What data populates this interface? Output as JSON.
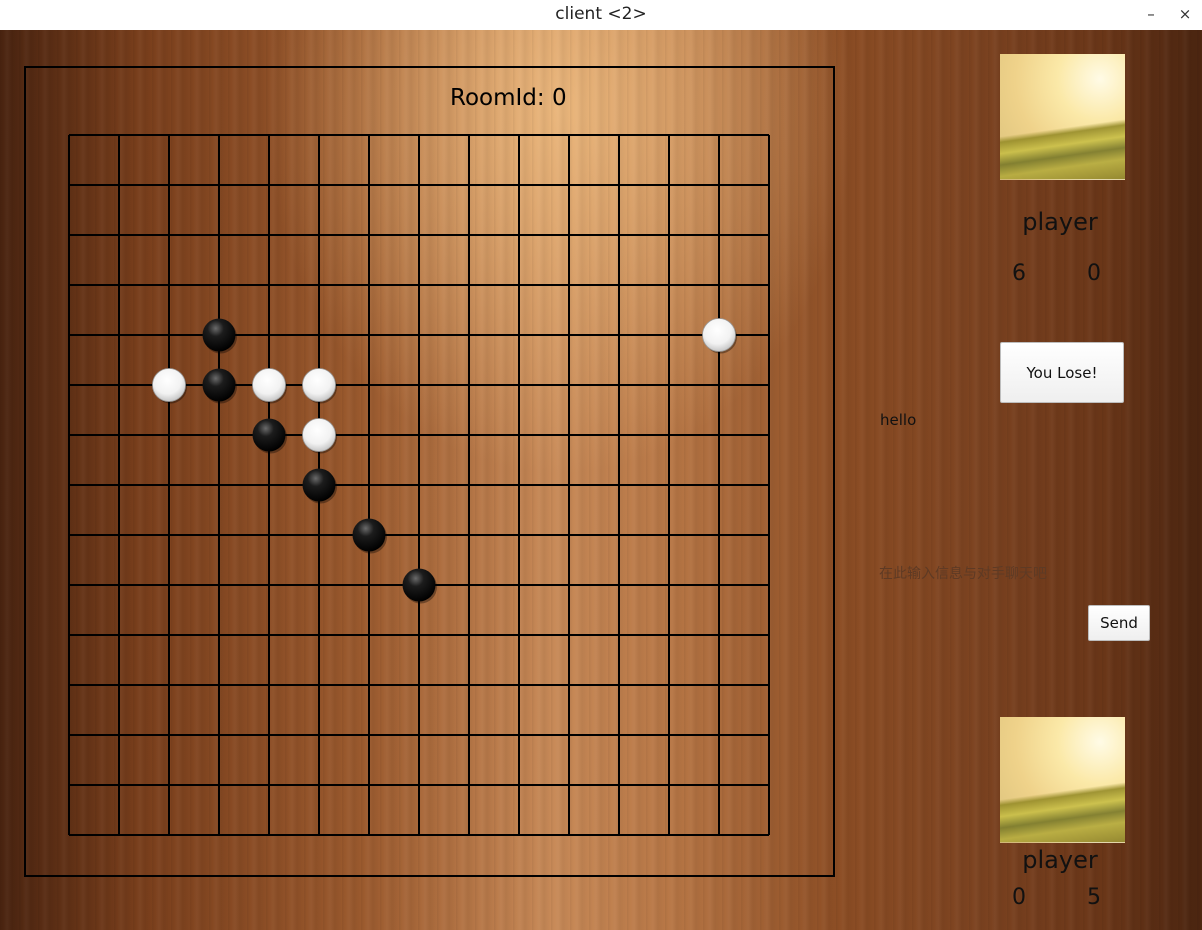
{
  "window": {
    "title": "client <2>",
    "minimize_glyph": "–",
    "close_glyph": "×"
  },
  "room": {
    "label": "RoomId: 0"
  },
  "board": {
    "size": 15,
    "black_stones": [
      [
        3,
        4
      ],
      [
        3,
        5
      ],
      [
        4,
        6
      ],
      [
        5,
        7
      ],
      [
        6,
        8
      ],
      [
        7,
        9
      ]
    ],
    "white_stones": [
      [
        2,
        5
      ],
      [
        4,
        5
      ],
      [
        5,
        5
      ],
      [
        5,
        6
      ],
      [
        13,
        4
      ]
    ]
  },
  "players": {
    "top": {
      "name": "player",
      "score_a": "6",
      "score_b": "0",
      "avatar_icon": "landscape-avatar-icon"
    },
    "bottom": {
      "name": "player",
      "score_a": "0",
      "score_b": "5",
      "avatar_icon": "landscape-avatar-icon"
    }
  },
  "result_button": {
    "label": "You Lose!"
  },
  "chat": {
    "messages": [
      "hello"
    ],
    "input_placeholder": "在此输入信息与对手聊天吧",
    "input_value": "",
    "send_label": "Send"
  },
  "colors": {
    "grid": "#000000",
    "black_stone": "#111111",
    "white_stone": "#ffffff"
  }
}
